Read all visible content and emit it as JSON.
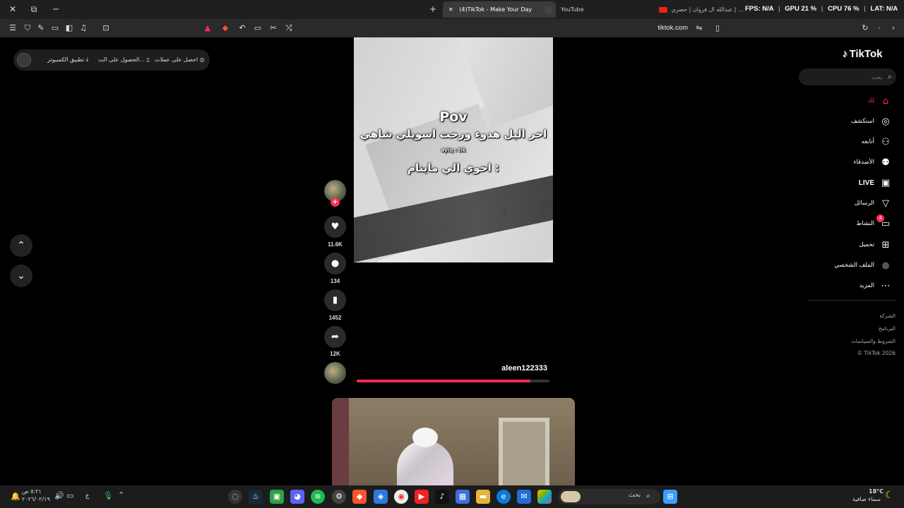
{
  "browser": {
    "window_controls": {
      "close": "✕",
      "restore": "⧉",
      "minimize": "─"
    },
    "new_tab": "+",
    "tabs": [
      {
        "label": "(4)TikTok - Make Your Day",
        "active": true,
        "close": "✕"
      },
      {
        "label": "YouTube",
        "active": false
      },
      {
        "label": "عبدالله ال فروان | حصري | ...",
        "active": false
      }
    ],
    "overlay_stats": {
      "fps": "FPS: N/A",
      "gpu": "GPU 21 %",
      "cpu": "CPU 76 %",
      "lat": "LAT: N/A"
    },
    "url": "tiktok.com"
  },
  "promo": {
    "coins": "احصل على عملات",
    "get_app": "الحصول على الت...",
    "desktop_app": "تطبيق الكمبيوتر"
  },
  "nav_buttons": {
    "up": "⌃",
    "down": "⌄"
  },
  "video": {
    "caption_title": "Pov",
    "caption_line1": "اخر اليل هدوء ورحت اسويلي شاهي",
    "caption_watermark": "ayiq : tik",
    "caption_line2": "اخوي الي ماينام :",
    "likes": "11.6K",
    "comments": "134",
    "saves": "1452",
    "shares": "12K",
    "username": "aleen122333",
    "progress": 0.9
  },
  "sidebar": {
    "logo": "TikTok",
    "search_placeholder": "بحث",
    "items": [
      {
        "label": "لك",
        "icon": "home-icon",
        "active": true
      },
      {
        "label": "استكشف",
        "icon": "compass-icon"
      },
      {
        "label": "أتابعه",
        "icon": "following-icon"
      },
      {
        "label": "الأصدقاء",
        "icon": "friends-icon"
      },
      {
        "label": "LIVE",
        "icon": "live-icon"
      },
      {
        "label": "الرسائل",
        "icon": "messages-icon"
      },
      {
        "label": "النشاط",
        "icon": "activity-icon",
        "badge": "4"
      },
      {
        "label": "تحميل",
        "icon": "upload-icon"
      },
      {
        "label": "الملف الشخصي",
        "icon": "profile-icon"
      },
      {
        "label": "المزيد",
        "icon": "more-icon"
      }
    ],
    "footer": [
      "الشركة",
      "البرنامج",
      "الشروط والسياسات",
      "© TikTok 2026"
    ]
  },
  "taskbar": {
    "weather_temp": "18°C",
    "weather_desc": "سماء صافية",
    "search_placeholder": "بحث",
    "clock_time": "٥:٢١ ص",
    "clock_date": "٢٠٢٦/٠٢/١٩",
    "lang": "ع"
  },
  "colors": {
    "accent": "#fe2c55",
    "background": "#000000",
    "panel": "#1e1e1e"
  }
}
